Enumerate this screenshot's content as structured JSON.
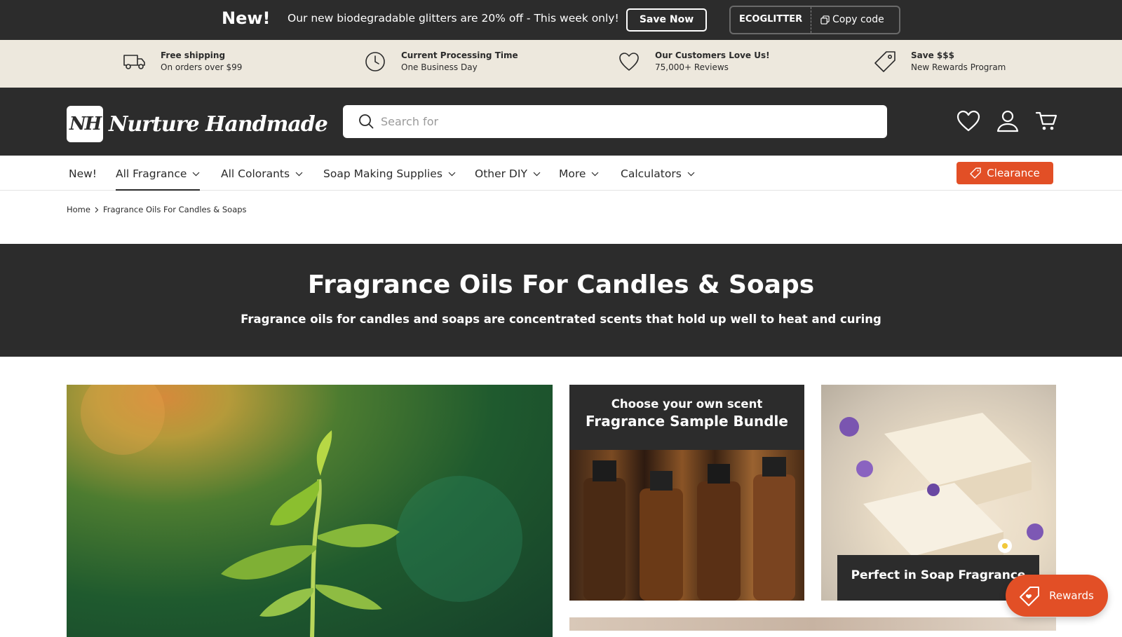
{
  "announcement": {
    "new_label": "New!",
    "message": "Our new biodegradable glitters are 20% off - This week only!",
    "cta_label": "Save Now",
    "code": "ECOGLITTER",
    "copy_label": "Copy code"
  },
  "usp": [
    {
      "icon": "truck-icon",
      "title": "Free shipping",
      "subtitle": "On orders over $99"
    },
    {
      "icon": "clock-icon",
      "title": "Current Processing Time",
      "subtitle": "One Business Day"
    },
    {
      "icon": "heart-icon",
      "title": "Our Customers Love Us!",
      "subtitle": "75,000+ Reviews"
    },
    {
      "icon": "tag-icon",
      "title": "Save $$$",
      "subtitle": "New Rewards Program"
    }
  ],
  "header": {
    "logo_mark": "NH",
    "logo_text": "Nurture Handmade",
    "search_placeholder": "Search for",
    "icons": [
      "wishlist-icon",
      "account-icon",
      "cart-icon"
    ]
  },
  "nav": {
    "items": [
      {
        "label": "New!",
        "dropdown": false
      },
      {
        "label": "All Fragrance",
        "dropdown": true,
        "active": true
      },
      {
        "label": "All Colorants",
        "dropdown": true
      },
      {
        "label": "Soap Making Supplies",
        "dropdown": true
      },
      {
        "label": "Other DIY",
        "dropdown": true
      },
      {
        "label": "More",
        "dropdown": true
      },
      {
        "label": "Calculators",
        "dropdown": true
      }
    ],
    "clearance_label": "Clearance"
  },
  "breadcrumb": {
    "home": "Home",
    "current": "Fragrance Oils For Candles & Soaps"
  },
  "hero": {
    "title": "Fragrance Oils For Candles & Soaps",
    "subtitle": "Fragrance oils for candles and soaps are concentrated scents that hold up well to heat and curing"
  },
  "tiles": {
    "sample_bundle": {
      "line1": "Choose your own scent",
      "line2": "Fragrance Sample Bundle"
    },
    "soap": {
      "caption": "Perfect in Soap Fragrance"
    }
  },
  "rewards": {
    "label": "Rewards"
  },
  "colors": {
    "dark": "#2c2c2c",
    "cream": "#ede8dd",
    "accent": "#e24f26"
  }
}
